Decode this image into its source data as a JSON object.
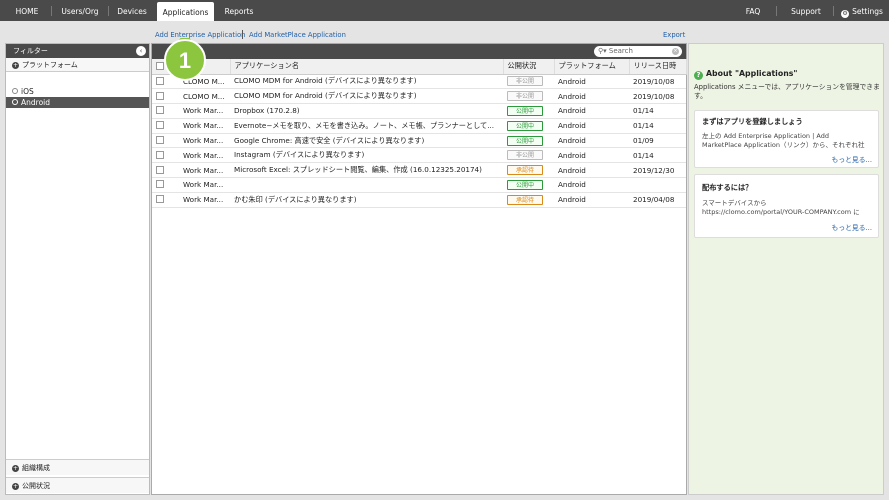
{
  "nav": {
    "home": "HOME",
    "users_org": "Users/Org",
    "devices": "Devices",
    "applications": "Applications",
    "reports": "Reports",
    "faq": "FAQ",
    "support": "Support",
    "settings": "Settings"
  },
  "actions": {
    "add_enterprise": "Add Enterprise Application",
    "add_marketplace": "Add MarketPlace Application",
    "export": "Export"
  },
  "callout": {
    "number": "1"
  },
  "sidebar": {
    "title": "フィルター",
    "platform_section": "プラットフォーム",
    "items": [
      {
        "label": "iOS",
        "selected": false
      },
      {
        "label": "Android",
        "selected": true
      }
    ],
    "bottom_sections": [
      "組織構成",
      "公開状況"
    ]
  },
  "search": {
    "placeholder": "Search"
  },
  "table": {
    "columns": [
      "",
      "",
      "アプリケーション名",
      "公開状況",
      "プラットフォーム",
      "リリース日時"
    ],
    "rows": [
      {
        "type": "CLOMO M...",
        "name": "CLOMO MDM for Android (デバイスにより異なります)",
        "status": "非公開",
        "status_kind": "private",
        "platform": "Android",
        "date": "2019/10/08"
      },
      {
        "type": "CLOMO M...",
        "name": "CLOMO MDM for Android (デバイスにより異なります)",
        "status": "非公開",
        "status_kind": "private",
        "platform": "Android",
        "date": "2019/10/08"
      },
      {
        "type": "Work Mar...",
        "name": "Dropbox (170.2.8)",
        "status": "公開中",
        "status_kind": "public",
        "platform": "Android",
        "date": "01/14"
      },
      {
        "type": "Work Mar...",
        "name": "Evernote−メモを取り、メモを書き込み。ノート、メモ帳、プランナーとして...",
        "status": "公開中",
        "status_kind": "public",
        "platform": "Android",
        "date": "01/14"
      },
      {
        "type": "Work Mar...",
        "name": "Google Chrome: 高速で安全 (デバイスにより異なります)",
        "status": "公開中",
        "status_kind": "public",
        "platform": "Android",
        "date": "01/09"
      },
      {
        "type": "Work Mar...",
        "name": "Instagram (デバイスにより異なります)",
        "status": "非公開",
        "status_kind": "private",
        "platform": "Android",
        "date": "01/14"
      },
      {
        "type": "Work Mar...",
        "name": "Microsoft Excel: スプレッドシート閲覧、編集、作成 (16.0.12325.20174)",
        "status": "承認待",
        "status_kind": "pending",
        "platform": "Android",
        "date": "2019/12/30"
      },
      {
        "type": "Work Mar...",
        "name": "",
        "status": "公開中",
        "status_kind": "public",
        "platform": "Android",
        "date": ""
      },
      {
        "type": "Work Mar...",
        "name": "かむ朱印 (デバイスにより異なります)",
        "status": "承認待",
        "status_kind": "pending",
        "platform": "Android",
        "date": "2019/04/08"
      }
    ]
  },
  "right_panel": {
    "title": "About \"Applications\"",
    "description": "Applications メニューでは、アプリケーションを管理できます。",
    "cards": [
      {
        "title": "まずはアプリを登録しましょう",
        "lines": [
          "左上の Add Enterprise Application | Add",
          "MarketPlace Application（リンク）から、それぞれ社"
        ],
        "more": "もっと見る..."
      },
      {
        "title": "配布するには？",
        "lines": [
          "スマートデバイスから",
          "https://clomo.com/portal/YOUR-COMPANY.com に"
        ],
        "more": "もっと見る..."
      }
    ]
  },
  "colors": {
    "nav_bg": "#4a4a4a",
    "link": "#1f5fa8",
    "callout": "#8cc63f",
    "public": "#2a9a3a",
    "pending": "#d98a1a"
  }
}
